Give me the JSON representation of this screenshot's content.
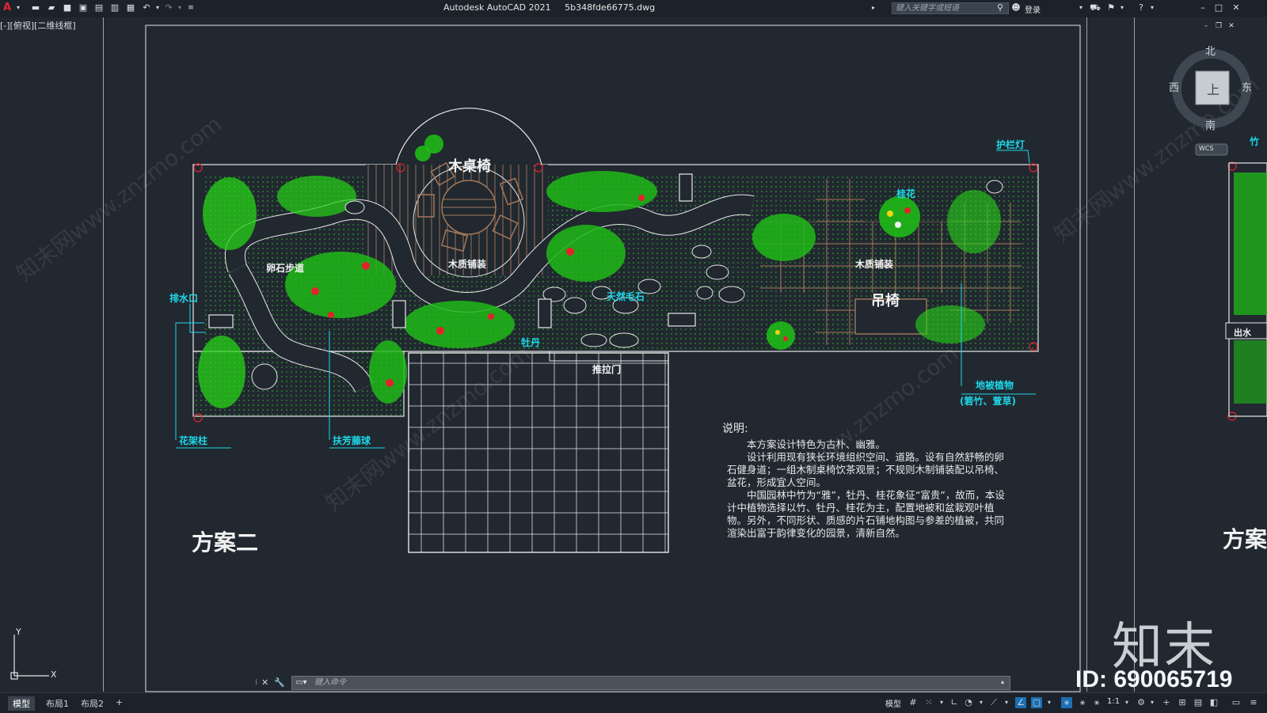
{
  "app": {
    "title": "Autodesk AutoCAD 2021",
    "filename": "5b348fde66775.dwg",
    "search_placeholder": "键入关键字或短语",
    "login": "登录",
    "viewport_label": "[-][俯视][二维线框]"
  },
  "viewcube": {
    "north": "北",
    "south": "南",
    "east": "东",
    "west": "西",
    "face": "上",
    "wcs": "WCS"
  },
  "plan": {
    "labels": {
      "tables": "木桌椅",
      "wood_paving_center": "木质铺装",
      "wood_paving_right": "木质铺装",
      "pebble_path": "卵石步道",
      "natural_stone": "天然毛石",
      "swing_chair": "吊椅",
      "sliding_door": "推拉门",
      "peony": "牡丹",
      "osmanthus": "桂花",
      "rail_light": "护栏灯",
      "drain": "排水口",
      "pergola_post": "花架柱",
      "climbing_vine": "扶芳藤球",
      "ground_cover": "地被植物",
      "ground_cover_detail": "(箬竹、萱草)",
      "scheme_title": "方案二",
      "scheme_partial": "方案",
      "bamboo_partial": "竹",
      "outlet_partial": "出水"
    },
    "colors": {
      "plant": "#27d317",
      "plant_dark": "#0f7a10",
      "wood": "#a4785a",
      "cyan_label": "#1ed8e8",
      "boundary": "#e8e8e8",
      "red": "#e5222a"
    }
  },
  "notes": {
    "heading": "说明:",
    "paragraphs": [
      "本方案设计特色为古朴、幽雅。",
      "设计利用现有狭长环境组织空间、道路。设有自然舒畅的卵石健身道；一组木制桌椅饮茶观景；不规则木制铺装配以吊椅、盆花，形成宜人空间。",
      "中国园林中竹为“雅”，牡丹、桂花象征“富贵”，故而，本设计中植物选择以竹、牡丹、桂花为主，配置地被和盆栽观叶植物。另外，不同形状、质感的片石铺地构图与参差的植被，共同渲染出富于韵律变化的园景，清新自然。"
    ]
  },
  "command": {
    "placeholder": "键入命令"
  },
  "ucs": {
    "x": "X",
    "y": "Y"
  },
  "tabs": [
    "模型",
    "布局1",
    "布局2"
  ],
  "statusbar": {
    "model": "模型",
    "scale": "1:1"
  },
  "watermark": {
    "site": "www.znzmo.com",
    "brand": "知末网",
    "logo": "知末",
    "id": "ID: 690065719"
  }
}
